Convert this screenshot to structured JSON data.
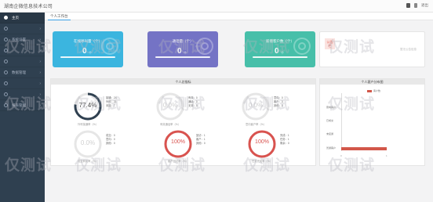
{
  "header": {
    "brand": "湖南企微信息技术公司",
    "logout_label": "退出"
  },
  "sidebar": {
    "items": [
      {
        "label": "主页",
        "icon": "home-icon",
        "active": true
      },
      {
        "label": "",
        "icon": "circle-icon"
      },
      {
        "label": "系统设置",
        "icon": "settings-icon"
      },
      {
        "label": "",
        "icon": "circle-icon"
      },
      {
        "label": "",
        "icon": "circle-icon"
      },
      {
        "label": "数据管理",
        "icon": "data-icon"
      },
      {
        "label": "",
        "icon": "circle-icon"
      },
      {
        "label": "",
        "icon": "circle-icon"
      },
      {
        "label": "报表管理",
        "icon": "report-icon"
      }
    ]
  },
  "tabs": [
    {
      "label": "个人工作台"
    }
  ],
  "stats": [
    {
      "title": "在线呼叫量（个）",
      "value": "0",
      "unit": "个",
      "color": "#3bb5df"
    },
    {
      "title": "通话量（个）",
      "value": "0",
      "unit": "个",
      "color": "#7473c5"
    },
    {
      "title": "新增客户数（个）",
      "value": "0",
      "unit": "个",
      "color": "#47bfa9"
    }
  ],
  "notice": {
    "badge": "公告栏",
    "text": "暂无公告信息"
  },
  "personal_panel": {
    "title": "个人总指标",
    "gauges": [
      {
        "value": "77.4%",
        "caption": "外呼接通率（%）",
        "style": "dark",
        "side": [
          "接通：24",
          "外呼：31",
          "未接：7"
        ]
      },
      {
        "value": "0.0%",
        "caption": "有效通话率（%）",
        "style": "muted",
        "side": [
          "有效：0",
          "通话：0",
          "无效：0"
        ]
      },
      {
        "value": "0.0%",
        "caption": "意向客户率（%）",
        "style": "muted",
        "side": [
          "意向：0",
          "客户：0",
          "其他：0"
        ]
      },
      {
        "value": "0.0%",
        "caption": "成交转化率（%）",
        "style": "muted",
        "side": [
          "成交：0",
          "意向：0",
          "其他：0"
        ]
      },
      {
        "value": "100%",
        "caption": "客户回访率（%）",
        "style": "red",
        "side": [
          "回访：1",
          "客户：1",
          "其他：0"
        ]
      },
      {
        "value": "100%",
        "caption": "任务完成率（%）",
        "style": "red",
        "side": [
          "完成：1",
          "任务：1",
          "剩余：0"
        ]
      }
    ]
  },
  "distribution_panel": {
    "title": "个人客户分布图",
    "legend": "客户数",
    "categories": [
      "意向客户",
      "已成交",
      "未接通",
      "普通客户"
    ],
    "values": [
      0,
      0,
      0,
      1
    ],
    "axis_ticks": [
      "0",
      "1"
    ]
  },
  "watermark": "仅测试"
}
